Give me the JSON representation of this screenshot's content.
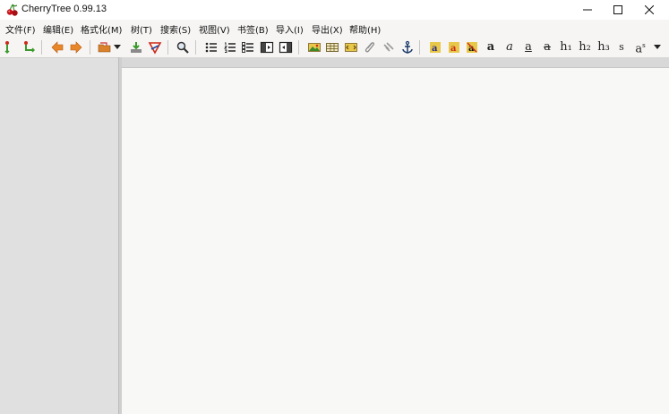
{
  "window": {
    "title": "CherryTree 0.99.13",
    "controls": [
      "minimize",
      "maximize",
      "close"
    ]
  },
  "menu": {
    "items": [
      {
        "label": "文件(F)"
      },
      {
        "label": "编辑(E)"
      },
      {
        "label": "格式化(M)"
      },
      {
        "label": "树(T)"
      },
      {
        "label": "搜索(S)"
      },
      {
        "label": "视图(V)"
      },
      {
        "label": "书签(B)"
      },
      {
        "label": "导入(I)"
      },
      {
        "label": "导出(X)"
      },
      {
        "label": "帮助(H)"
      }
    ]
  },
  "toolbar": {
    "icons": [
      "add-node-icon",
      "add-subnode-icon",
      "go-back-icon",
      "go-forward-icon",
      "open-icon",
      "dropdown-arrow-icon",
      "save-icon",
      "export-pdf-icon",
      "find-icon",
      "bulleted-list-icon",
      "numbered-list-icon",
      "todo-list-icon",
      "toggle-tree-icon",
      "toggle-toolbar-icon",
      "insert-image-icon",
      "insert-table-icon",
      "insert-codebox-icon",
      "insert-attachment-icon",
      "insert-link-icon",
      "insert-anchor-icon",
      "text-foreground-color-icon",
      "text-background-color-icon",
      "remove-formatting-icon"
    ],
    "format_glyphs": {
      "bold": "a",
      "italic": "a",
      "underline": "a",
      "strikethrough": "a",
      "h1": "h₁",
      "h2": "h₂",
      "h3": "h₃",
      "small": "s",
      "superscript": "a",
      "superscript_mark": "s"
    }
  },
  "colors": {
    "window_bg": "#f6f5f4",
    "sidebar_bg": "#e0e0e0",
    "editor_bg": "#f8f8f7",
    "arrow_orange": "#e8862a",
    "icon_green": "#3a9a2a",
    "icon_red": "#cc2a1a"
  }
}
